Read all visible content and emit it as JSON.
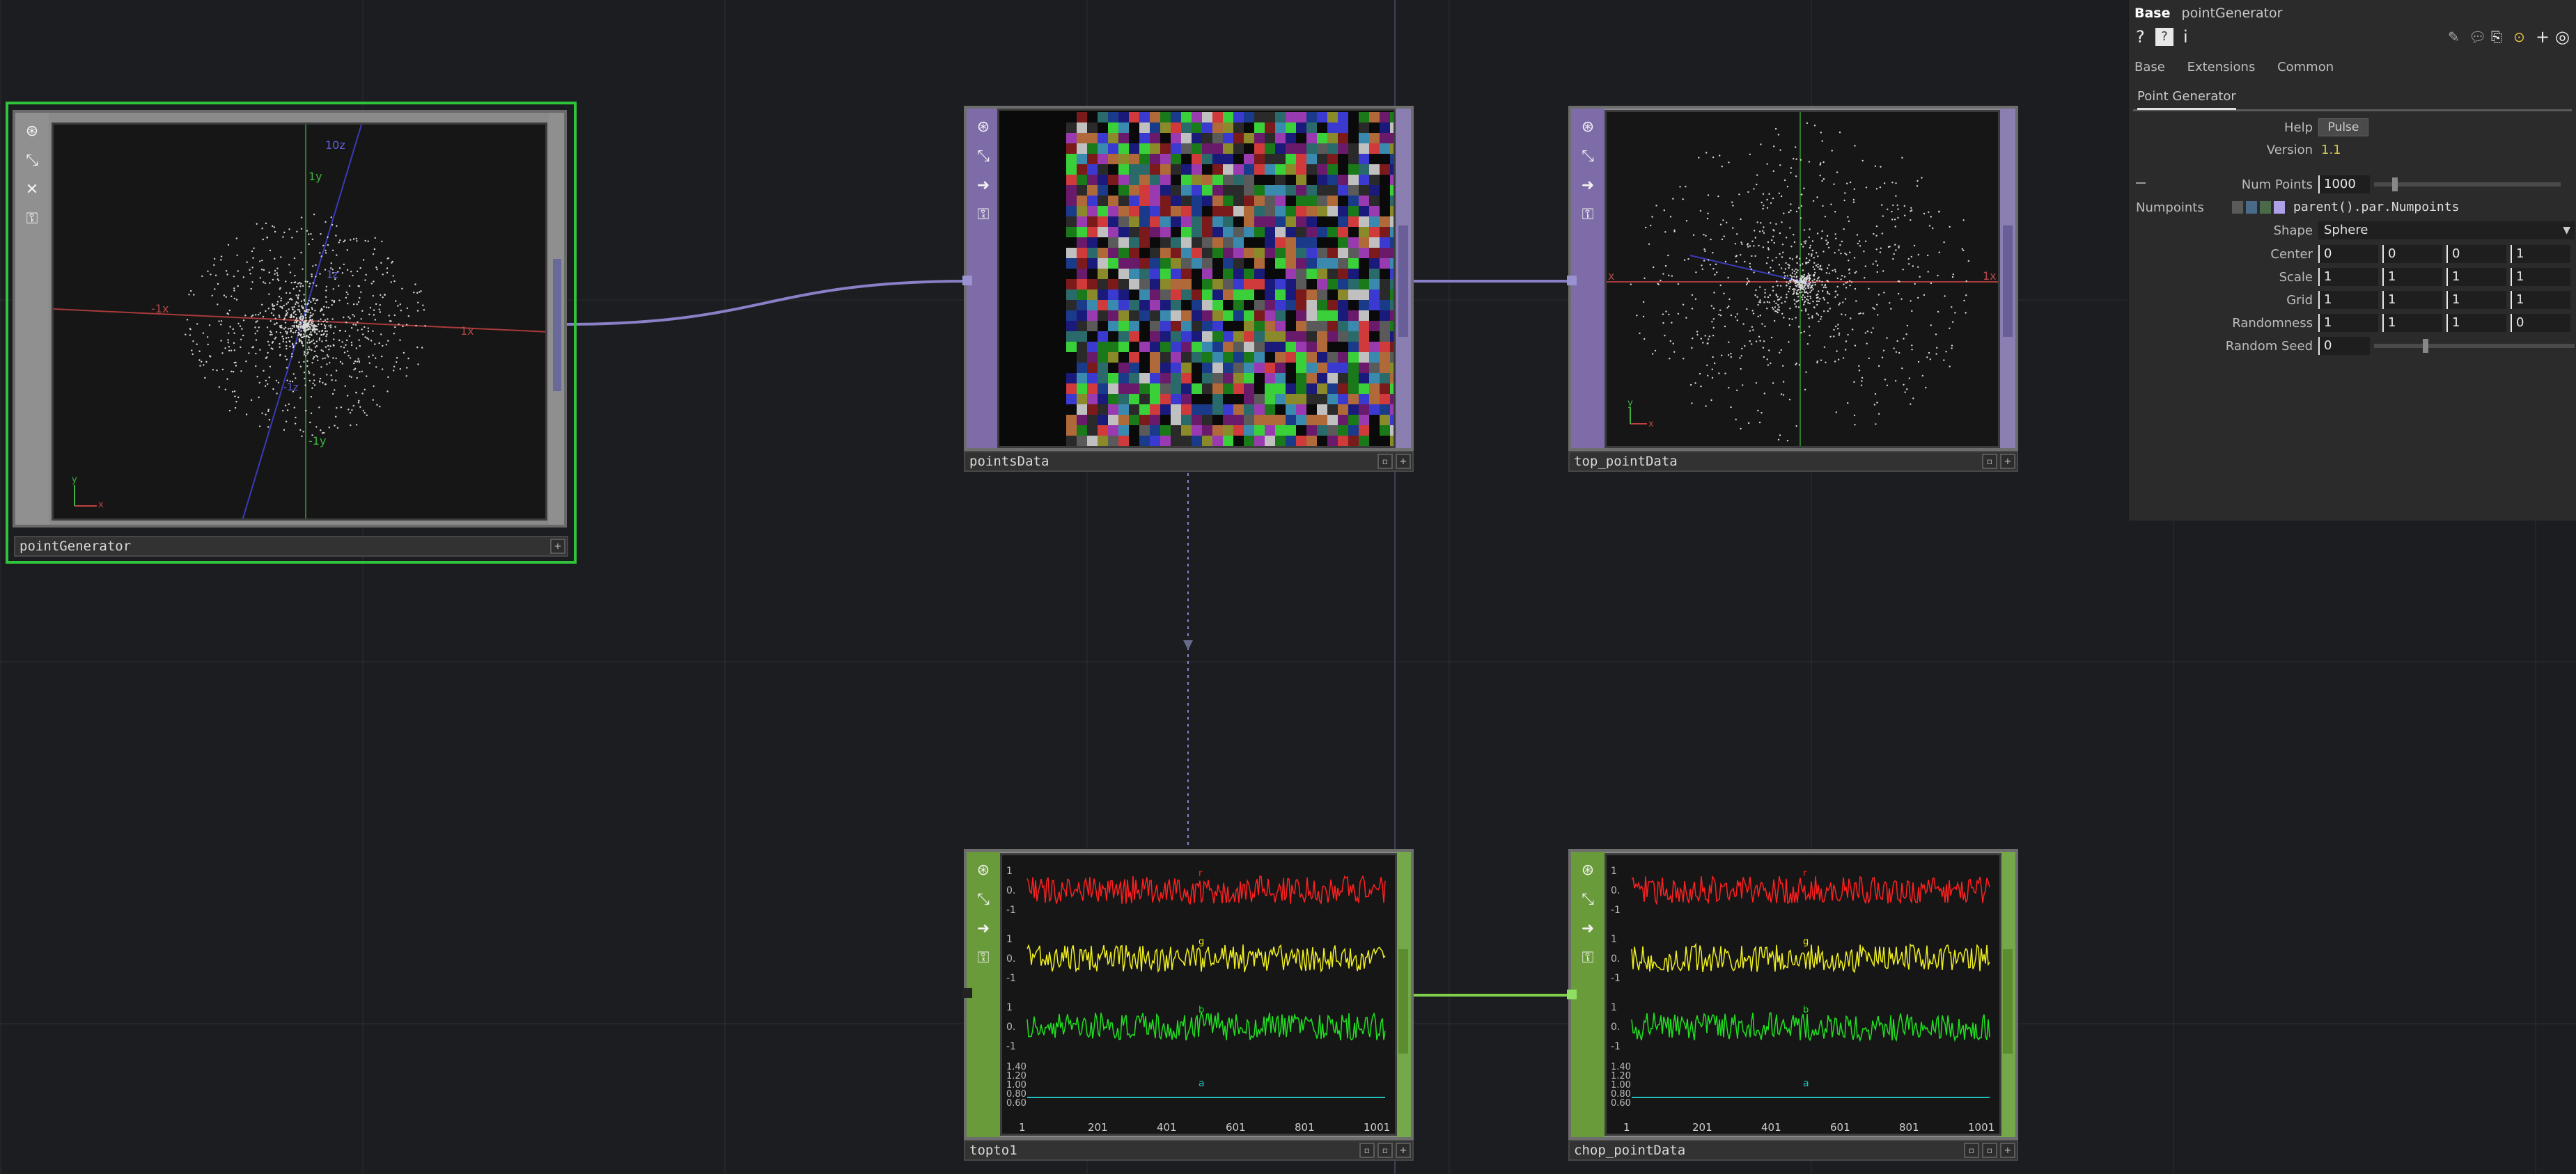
{
  "nodes": {
    "pointGenerator": {
      "name": "pointGenerator",
      "axis_labels": {
        "x_pos": "1x",
        "x_neg": "-1x",
        "y_pos": "1y",
        "y_neg": "-1y",
        "z_pos": "10z",
        "z1": "1z",
        "z_neg": "-1z"
      },
      "gizmo": {
        "x": "x",
        "y": "y"
      }
    },
    "pointsData": {
      "name": "pointsData"
    },
    "top_pointData": {
      "name": "top_pointData",
      "axis_labels": {
        "x_pos": "1x",
        "x_neg": "x",
        "gizmo_x": "x",
        "gizmo_y": "y"
      }
    },
    "topto1": {
      "name": "topto1",
      "channels": [
        {
          "name": "r",
          "color": "#ff2020",
          "ticks": [
            "1",
            "0.",
            "-1"
          ]
        },
        {
          "name": "g",
          "color": "#f0f020",
          "ticks": [
            "1",
            "0.",
            "-1"
          ]
        },
        {
          "name": "b",
          "color": "#20e020",
          "ticks": [
            "1",
            "0.",
            "-1"
          ]
        },
        {
          "name": "a",
          "color": "#20c0c0",
          "ticks": [
            "1.40",
            "1.20",
            "1.00",
            "0.80",
            "0.60"
          ]
        }
      ],
      "x_ticks": [
        "1",
        "201",
        "401",
        "601",
        "801",
        "1001"
      ]
    },
    "chop_pointData": {
      "name": "chop_pointData",
      "channels": [
        {
          "name": "r",
          "color": "#ff2020",
          "ticks": [
            "1",
            "0.",
            "-1"
          ]
        },
        {
          "name": "g",
          "color": "#f0f020",
          "ticks": [
            "1",
            "0.",
            "-1"
          ]
        },
        {
          "name": "b",
          "color": "#20e020",
          "ticks": [
            "1",
            "0.",
            "-1"
          ]
        },
        {
          "name": "a",
          "color": "#20c0c0",
          "ticks": [
            "1.40",
            "1.20",
            "1.00",
            "0.80",
            "0.60"
          ]
        }
      ],
      "x_ticks": [
        "1",
        "201",
        "401",
        "601",
        "801",
        "1001"
      ]
    }
  },
  "side_icons": [
    "viewer-toggle-icon",
    "bypass-icon",
    "export-icon",
    "lock-icon"
  ],
  "params": {
    "type": "Base",
    "op_name": "pointGenerator",
    "tabs": [
      "Base",
      "Extensions",
      "Common"
    ],
    "page": "Point Generator",
    "rows": {
      "help": {
        "label": "Help",
        "button": "Pulse"
      },
      "version": {
        "label": "Version",
        "value": "1.1"
      },
      "num_points": {
        "label": "Num Points",
        "value": "1000",
        "fraction": 0.1
      },
      "numpoints_expr": {
        "label": "Numpoints",
        "expr": "parent().par.Numpoints"
      },
      "shape": {
        "label": "Shape",
        "value": "Sphere"
      },
      "center": {
        "label": "Center",
        "values": [
          "0",
          "0",
          "0",
          "1"
        ]
      },
      "scale": {
        "label": "Scale",
        "values": [
          "1",
          "1",
          "1",
          "1"
        ]
      },
      "grid": {
        "label": "Grid",
        "values": [
          "1",
          "1",
          "1",
          "1"
        ]
      },
      "randomness": {
        "label": "Randomness",
        "values": [
          "1",
          "1",
          "1",
          "0"
        ]
      },
      "random_seed": {
        "label": "Random Seed",
        "value": "0",
        "fraction": 0.25
      }
    }
  },
  "colors": {
    "selection": "#2fc43a",
    "top_wire": "#8a80c8",
    "chop_wire": "#7fd04a",
    "top_color": "#7e6ca8",
    "chop_color": "#6a9b3a"
  }
}
